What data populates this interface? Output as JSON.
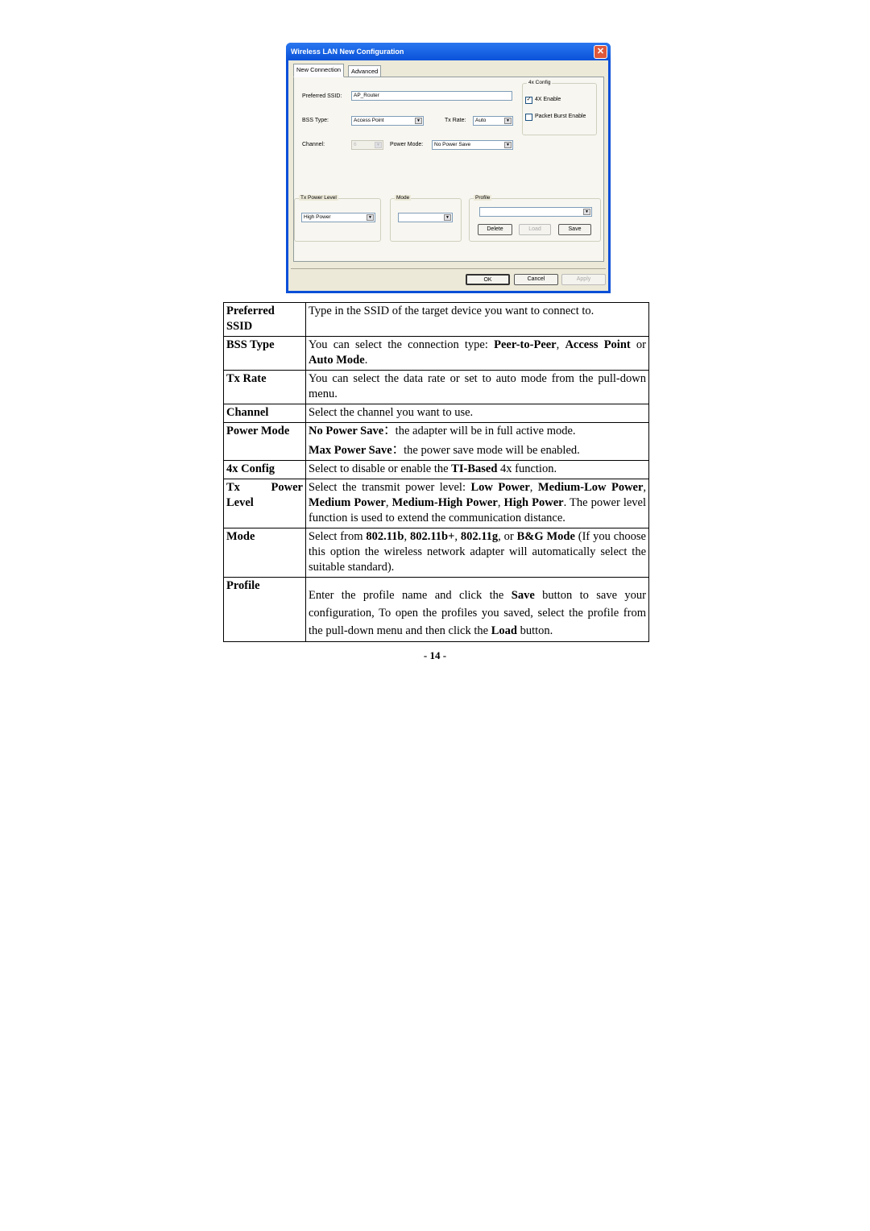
{
  "dialog": {
    "title": "Wireless LAN New Configuration",
    "close_glyph": "✕",
    "tabs": [
      "New Connection",
      "Advanced"
    ],
    "preferred_ssid_label": "Preferred SSID:",
    "preferred_ssid_value": "AP_Router",
    "bss_type_label": "BSS Type:",
    "bss_type_value": "Access Point",
    "tx_rate_label": "Tx Rate:",
    "tx_rate_value": "Auto",
    "channel_label": "Channel:",
    "channel_value": "6",
    "power_mode_label": "Power Mode:",
    "power_mode_value": "No Power Save",
    "config4x": {
      "label": "4x Config",
      "enable_label": "4X Enable",
      "enable_checked": "✓",
      "burst_label": "Packet Burst Enable"
    },
    "tx_power": {
      "label": "Tx Power Level",
      "value": "High Power"
    },
    "mode": {
      "label": "Mode",
      "value": ""
    },
    "profile": {
      "label": "Profile",
      "value": "",
      "delete": "Delete",
      "load": "Load",
      "save": "Save"
    },
    "ok": "OK",
    "cancel": "Cancel",
    "apply": "Apply",
    "dropdown_glyph": "▼"
  },
  "table": [
    {
      "key": "Preferred SSID",
      "html": "Type in the SSID of the target device you want to connect to."
    },
    {
      "key": "BSS Type",
      "html": "You can select the connection type: <b>Peer-to-Peer</b>, <b>Access Point</b> or <b>Auto Mode</b>."
    },
    {
      "key": "Tx Rate",
      "html": "You can select the data rate or set to auto mode from the pull-down menu."
    },
    {
      "key": "Channel",
      "html": "Select the channel you want to use."
    },
    {
      "key": "Power Mode",
      "html": "<b>No Power Save</b>：the adapter will be in full active mode.<br><span style='display:block;margin-top:5px'><b>Max Power Save</b>：the power save mode will be enabled.</span>"
    },
    {
      "key": "4x Config",
      "html": "Select to disable or enable the <b>TI-Based</b> 4x function."
    },
    {
      "key": "Tx Power Level",
      "html": "Select the transmit power level: <b>Low Power</b>, <b>Medium-Low Power</b>, <b>Medium Power</b>, <b>Medium-High Power</b>, <b>High Power</b>. The power level function is used to extend the communication distance."
    },
    {
      "key": "Mode",
      "html": "Select from <b>802.11b</b>, <b>802.11b+</b>, <b>802.11g</b>, or <b>B&amp;G Mode</b> (If you choose this option the wireless network adapter will automatically select the suitable standard)."
    },
    {
      "key": "Profile",
      "html": "<span style='display:block;margin-top:10px;line-height:22px'>Enter the profile name and click the <b>Save</b> button to save your configuration, To open the profiles you saved, select the profile from the pull-down menu and then click the <b>Load</b> button.</span>"
    }
  ],
  "page_number": "- 14 -"
}
